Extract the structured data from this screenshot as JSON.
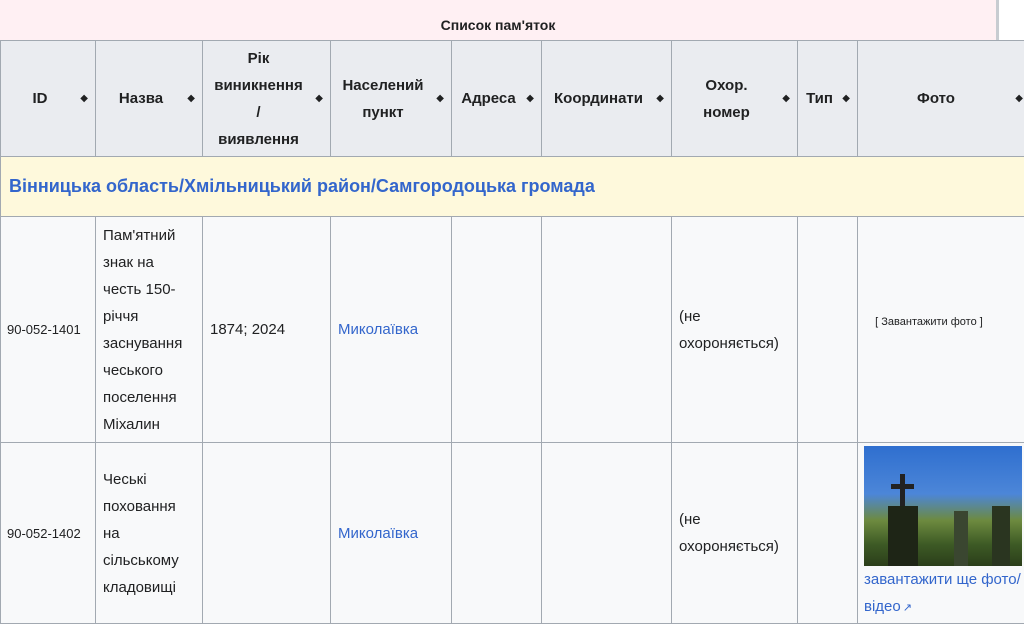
{
  "caption": "Список пам'яток",
  "columns": [
    {
      "label": "ID",
      "key": "id"
    },
    {
      "label": "Назва",
      "key": "name"
    },
    {
      "label": "Рік виникнення / виявлення",
      "key": "year"
    },
    {
      "label": "Населений пункт",
      "key": "settlement"
    },
    {
      "label": "Адреса",
      "key": "address"
    },
    {
      "label": "Координати",
      "key": "coords"
    },
    {
      "label": "Охор. номер",
      "key": "protection"
    },
    {
      "label": "Тип",
      "key": "type"
    },
    {
      "label": "Фото",
      "key": "photo"
    }
  ],
  "header_lines": {
    "year": [
      "Рік",
      "виникнення",
      "/",
      "виявлення"
    ],
    "settlement": [
      "Населений",
      "пункт"
    ],
    "protection": [
      "Охор.",
      "номер"
    ]
  },
  "sort_glyph": "◆",
  "region": "Вінницька область/Хмільницький район/Самгородоцька громада",
  "rows": [
    {
      "id": "90-052-1401",
      "name": "Пам'ятний знак на честь 150-річчя заснування чеського поселення Міхалин",
      "year": "1874; 2024",
      "settlement": "Миколаївка",
      "address": "",
      "coords": "",
      "protection": "(не охороняється)",
      "type": "",
      "photo_upload": "[ Завантажити фото ]"
    },
    {
      "id": "90-052-1402",
      "name": "Чеські поховання на сільському кладовищі",
      "year": "",
      "settlement": "Миколаївка",
      "address": "",
      "coords": "",
      "protection": "(не охороняється)",
      "type": "",
      "photo_link": "завантажити ще фото/відео"
    }
  ],
  "icons": {
    "external_link": "external-link-icon"
  },
  "colors": {
    "link": "#3366cc",
    "header_bg": "#eaecf0",
    "region_bg": "#fef9dc",
    "caption_bg": "#fff0f3"
  }
}
